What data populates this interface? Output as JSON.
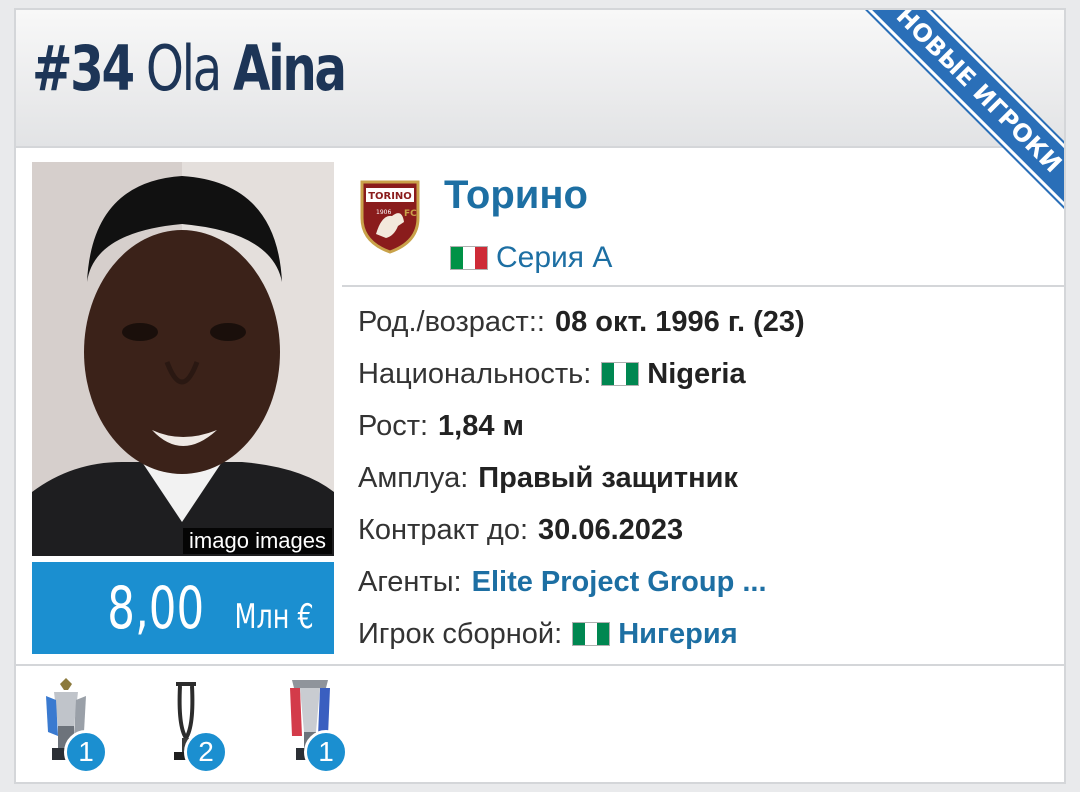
{
  "header": {
    "number": "#34",
    "first_name": "Ola",
    "last_name": "Aina",
    "ribbon": "НОВЫЕ ИГРОКИ"
  },
  "photo": {
    "credit": "imago images"
  },
  "market_value": {
    "amount": "8,00",
    "unit": "Млн €"
  },
  "club": {
    "name": "Торино",
    "logo_text": "TORINO",
    "logo_year": "1906",
    "logo_fc": "FC",
    "league": "Серия А",
    "league_flag": "italy-flag-icon"
  },
  "info": [
    {
      "label": "Род./возраст::",
      "value": "08 окт. 1996 г. (23)",
      "style": "val"
    },
    {
      "label": "Национальность:",
      "value": "Nigeria",
      "style": "val",
      "flag": "ng"
    },
    {
      "label": "Рост:",
      "value": "1,84 м",
      "style": "val"
    },
    {
      "label": "Амплуа:",
      "value": "Правый защитник",
      "style": "val"
    },
    {
      "label": "Контракт до:",
      "value": "30.06.2023",
      "style": "val"
    },
    {
      "label": "Агенты:",
      "value": "Elite Project Group ...",
      "style": "link"
    },
    {
      "label": "Игрок сборной:",
      "value": "Нигерия",
      "style": "link",
      "flag": "ng"
    }
  ],
  "trophies": [
    {
      "icon": "premier-league-trophy-icon",
      "count": "1"
    },
    {
      "icon": "league-cup-trophy-icon",
      "count": "2"
    },
    {
      "icon": "championship-trophy-icon",
      "count": "1"
    }
  ],
  "colors": {
    "accent_blue": "#1b8fd0",
    "link_blue": "#1d6fa3",
    "title_navy": "#1d3557",
    "ribbon_blue": "#2a6fb8"
  }
}
